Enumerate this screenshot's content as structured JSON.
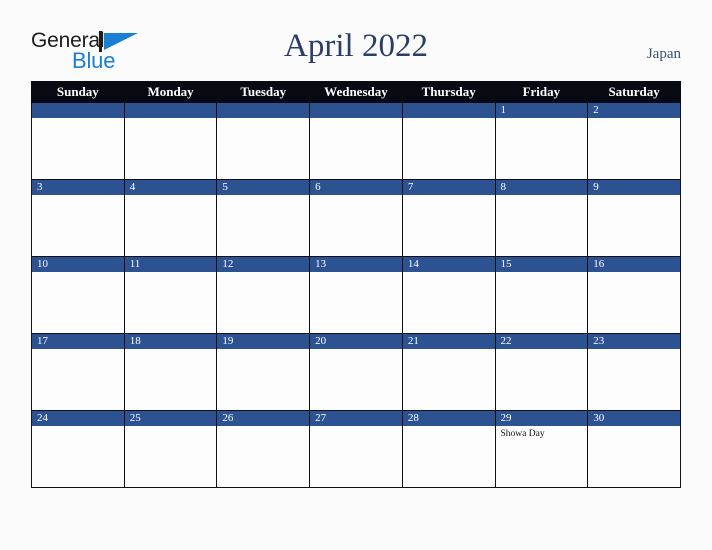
{
  "brand": {
    "word_one": "General",
    "word_two": "Blue",
    "mark": "triangle-logo"
  },
  "header": {
    "title": "April 2022",
    "country": "Japan"
  },
  "colors": {
    "header_bar": "#070a12",
    "daynum_bar": "#2c5291",
    "title_text": "#2b3f66",
    "brand_blue": "#1b7fd4",
    "page_background": "#fbfbfb"
  },
  "calendar": {
    "weekday_headers": [
      "Sunday",
      "Monday",
      "Tuesday",
      "Wednesday",
      "Thursday",
      "Friday",
      "Saturday"
    ],
    "weeks": [
      [
        {
          "day": "",
          "events": []
        },
        {
          "day": "",
          "events": []
        },
        {
          "day": "",
          "events": []
        },
        {
          "day": "",
          "events": []
        },
        {
          "day": "",
          "events": []
        },
        {
          "day": "1",
          "events": []
        },
        {
          "day": "2",
          "events": []
        }
      ],
      [
        {
          "day": "3",
          "events": []
        },
        {
          "day": "4",
          "events": []
        },
        {
          "day": "5",
          "events": []
        },
        {
          "day": "6",
          "events": []
        },
        {
          "day": "7",
          "events": []
        },
        {
          "day": "8",
          "events": []
        },
        {
          "day": "9",
          "events": []
        }
      ],
      [
        {
          "day": "10",
          "events": []
        },
        {
          "day": "11",
          "events": []
        },
        {
          "day": "12",
          "events": []
        },
        {
          "day": "13",
          "events": []
        },
        {
          "day": "14",
          "events": []
        },
        {
          "day": "15",
          "events": []
        },
        {
          "day": "16",
          "events": []
        }
      ],
      [
        {
          "day": "17",
          "events": []
        },
        {
          "day": "18",
          "events": []
        },
        {
          "day": "19",
          "events": []
        },
        {
          "day": "20",
          "events": []
        },
        {
          "day": "21",
          "events": []
        },
        {
          "day": "22",
          "events": []
        },
        {
          "day": "23",
          "events": []
        }
      ],
      [
        {
          "day": "24",
          "events": []
        },
        {
          "day": "25",
          "events": []
        },
        {
          "day": "26",
          "events": []
        },
        {
          "day": "27",
          "events": []
        },
        {
          "day": "28",
          "events": []
        },
        {
          "day": "29",
          "events": [
            "Showa Day"
          ]
        },
        {
          "day": "30",
          "events": []
        }
      ]
    ]
  }
}
